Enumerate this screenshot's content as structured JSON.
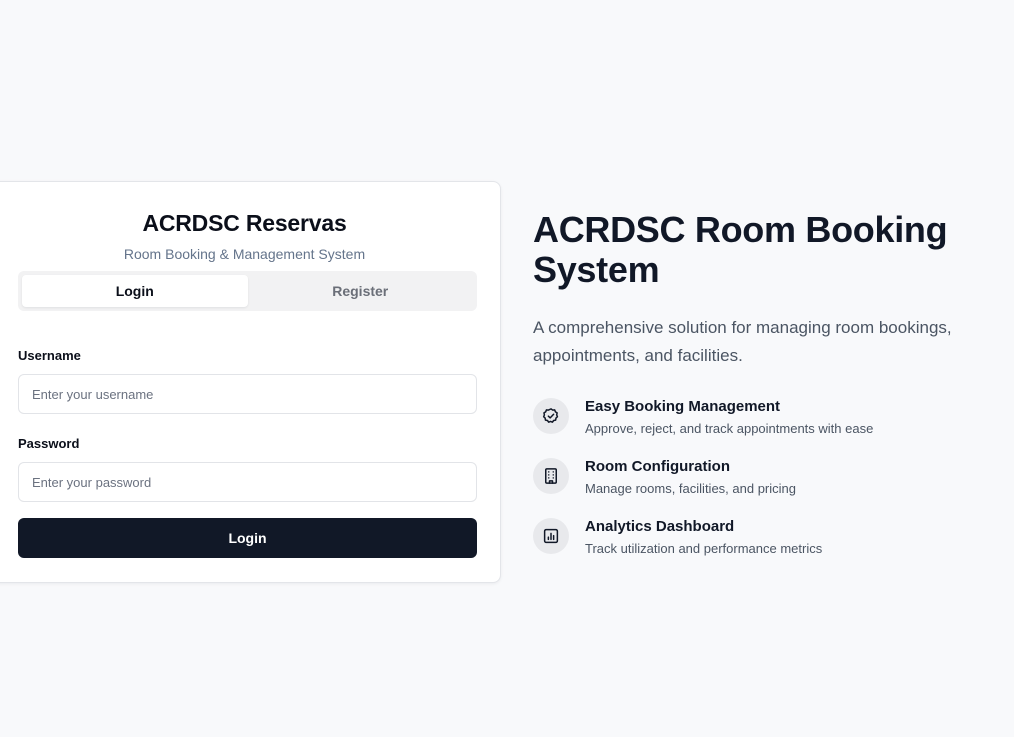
{
  "login_card": {
    "title": "ACRDSC Reservas",
    "subtitle": "Room Booking & Management System",
    "tabs": [
      {
        "label": "Login",
        "active": true
      },
      {
        "label": "Register",
        "active": false
      }
    ],
    "username": {
      "label": "Username",
      "placeholder": "Enter your username",
      "value": ""
    },
    "password": {
      "label": "Password",
      "placeholder": "Enter your password",
      "value": ""
    },
    "submit_label": "Login"
  },
  "hero": {
    "title": "ACRDSC Room Booking System",
    "description": "A comprehensive solution for managing room bookings, appointments, and facilities.",
    "features": [
      {
        "icon": "check-badge-icon",
        "title": "Easy Booking Management",
        "description": "Approve, reject, and track appointments with ease"
      },
      {
        "icon": "building-icon",
        "title": "Room Configuration",
        "description": "Manage rooms, facilities, and pricing"
      },
      {
        "icon": "bar-chart-icon",
        "title": "Analytics Dashboard",
        "description": "Track utilization and performance metrics"
      }
    ]
  },
  "colors": {
    "background": "#f8f9fb",
    "primary_button": "#111827",
    "icon_circle": "#e8e9ec"
  }
}
